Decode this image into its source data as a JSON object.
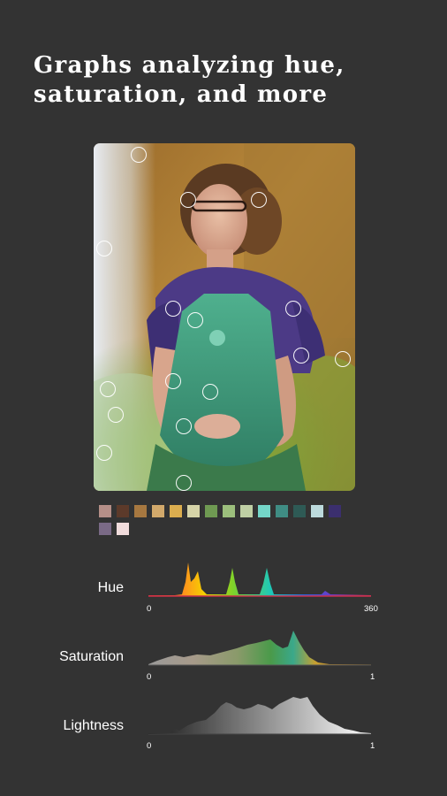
{
  "headline": {
    "line1": "Graphs analyzing hue,",
    "line2": "saturation, and more"
  },
  "palette": [
    "#b58f88",
    "#5c3a2a",
    "#a77840",
    "#d2a96b",
    "#dcae4f",
    "#d6d4a8",
    "#6f9a52",
    "#9cbf7c",
    "#bfcfa4",
    "#74d6c8",
    "#3f8d84",
    "#2e5a55",
    "#bcdadc",
    "#3b2f6e",
    "#7a6a86",
    "#f1dcdc"
  ],
  "graphs": {
    "hue": {
      "label": "Hue",
      "min": "0",
      "max": "360"
    },
    "saturation": {
      "label": "Saturation",
      "min": "0",
      "max": "1"
    },
    "lightness": {
      "label": "Lightness",
      "min": "0",
      "max": "1"
    }
  }
}
